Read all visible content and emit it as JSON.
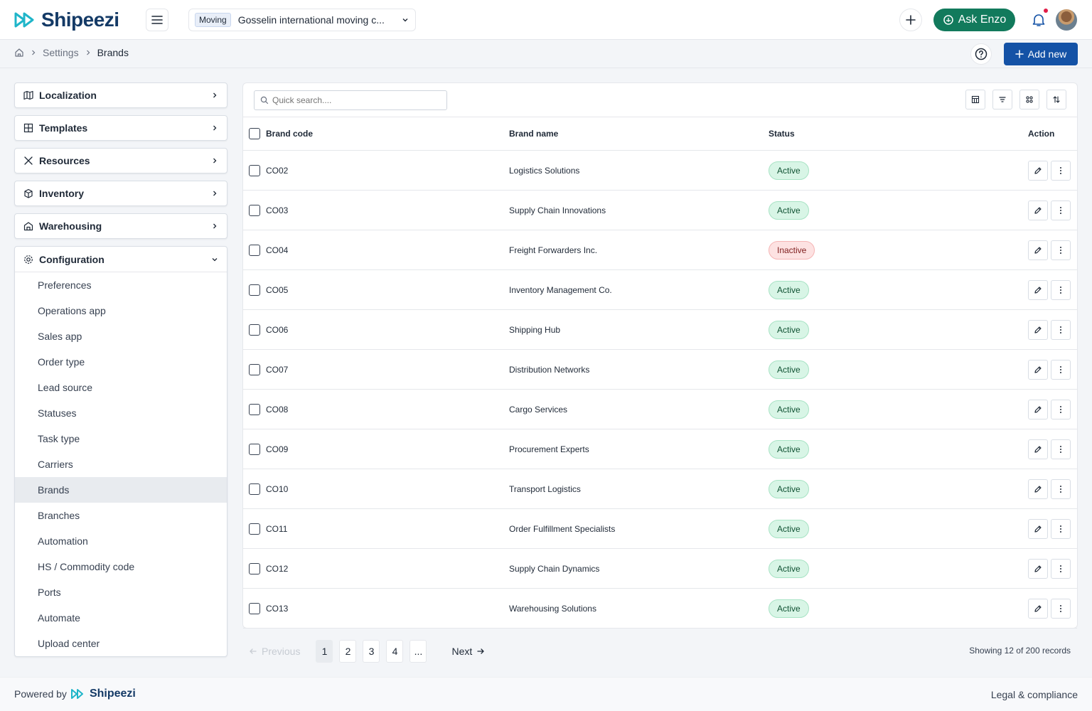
{
  "app": {
    "logo_text": "Shipeezi",
    "company_tag": "Moving",
    "company_name": "Gosselin international moving c...",
    "ask_label": "Ask Enzo"
  },
  "breadcrumb": {
    "settings": "Settings",
    "current": "Brands"
  },
  "header": {
    "add_new_label": "Add new"
  },
  "sidebar": {
    "sections": [
      {
        "label": "Localization",
        "icon": "map-icon"
      },
      {
        "label": "Templates",
        "icon": "layout-icon"
      },
      {
        "label": "Resources",
        "icon": "tools-icon"
      },
      {
        "label": "Inventory",
        "icon": "box-icon"
      },
      {
        "label": "Warehousing",
        "icon": "warehouse-icon"
      }
    ],
    "config_label": "Configuration",
    "config_items": [
      "Preferences",
      "Operations app",
      "Sales app",
      "Order type",
      "Lead source",
      "Statuses",
      "Task type",
      "Carriers",
      "Brands",
      "Branches",
      "Automation",
      "HS / Commodity code",
      "Ports",
      "Automate",
      "Upload center"
    ],
    "active_item": "Brands"
  },
  "table": {
    "search_placeholder": "Quick search....",
    "columns": {
      "code": "Brand code",
      "name": "Brand name",
      "status": "Status",
      "action": "Action"
    },
    "rows": [
      {
        "code": "CO02",
        "name": "Logistics Solutions",
        "status": "Active"
      },
      {
        "code": "CO03",
        "name": "Supply Chain Innovations",
        "status": "Active"
      },
      {
        "code": "CO04",
        "name": "Freight Forwarders Inc.",
        "status": "Inactive"
      },
      {
        "code": "CO05",
        "name": "Inventory Management Co.",
        "status": "Active"
      },
      {
        "code": "CO06",
        "name": "Shipping Hub",
        "status": "Active"
      },
      {
        "code": "CO07",
        "name": "Distribution Networks",
        "status": "Active"
      },
      {
        "code": "CO08",
        "name": "Cargo Services",
        "status": "Active"
      },
      {
        "code": "CO09",
        "name": "Procurement Experts",
        "status": "Active"
      },
      {
        "code": "CO10",
        "name": "Transport Logistics",
        "status": "Active"
      },
      {
        "code": "CO11",
        "name": "Order Fulfillment Specialists",
        "status": "Active"
      },
      {
        "code": "CO12",
        "name": "Supply Chain Dynamics",
        "status": "Active"
      },
      {
        "code": "CO13",
        "name": "Warehousing Solutions",
        "status": "Active"
      }
    ]
  },
  "pagination": {
    "previous_label": "Previous",
    "pages": [
      "1",
      "2",
      "3",
      "4",
      "..."
    ],
    "current_page": "1",
    "next_label": "Next",
    "showing_text": "Showing 12 of 200 records"
  },
  "footer": {
    "powered_label": "Powered by",
    "brand": "Shipeezi",
    "legal": "Legal & compliance"
  },
  "colors": {
    "brand_blue": "#1452a6",
    "ask_green": "#127a5c",
    "active_bg": "#d8f5e6",
    "inactive_bg": "#fde2e2"
  }
}
